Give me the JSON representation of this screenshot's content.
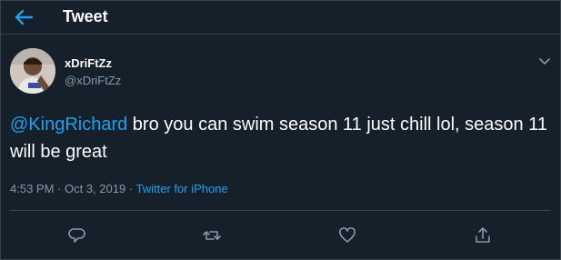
{
  "header": {
    "title": "Tweet",
    "back_icon": "back-arrow-icon",
    "accent": "#1da1f2"
  },
  "author": {
    "display_name": "xDriFtZz",
    "handle": "@xDriFtZz",
    "avatar_icon": "avatar-photo"
  },
  "tweet": {
    "mention": "@KingRichard",
    "body": " bro you can swim season 11 just chill lol, season 11 will be great"
  },
  "meta": {
    "time": "4:53 PM",
    "separator": " · ",
    "date": "Oct 3, 2019",
    "source": "Twitter for iPhone"
  },
  "actions": {
    "icons": [
      "reply-icon",
      "retweet-icon",
      "like-icon",
      "share-icon"
    ]
  },
  "colors": {
    "background": "#15202b",
    "text": "#ffffff",
    "muted": "#8899a6",
    "link": "#1da1f2",
    "border": "#38444d"
  }
}
